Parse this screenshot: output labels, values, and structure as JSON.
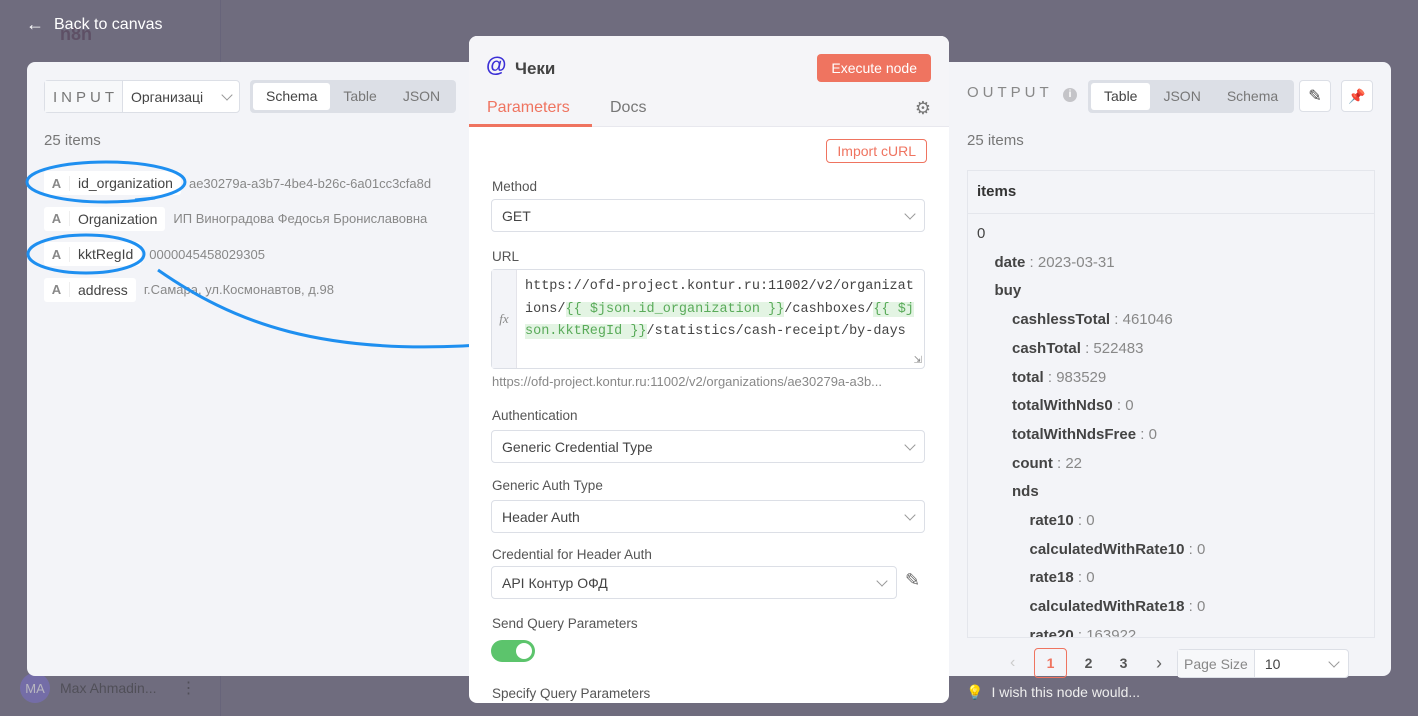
{
  "nav": {
    "back_label": "Back to canvas",
    "logo": "n8n",
    "user_initials": "MA",
    "user_name": "Max Ahmadin..."
  },
  "input": {
    "label": "INPUT",
    "source": "Организаці",
    "views": [
      "Schema",
      "Table",
      "JSON"
    ],
    "active_view": "Schema",
    "count": "25 items",
    "fields": [
      {
        "type": "A",
        "key": "id_organization",
        "value": "ae30279a-a3b7-4be4-b26c-6a01cc3cfa8d"
      },
      {
        "type": "A",
        "key": "Organization",
        "value": "ИП Виноградова Федосья Брониславовна"
      },
      {
        "type": "A",
        "key": "kktRegId",
        "value": "0000045458029305"
      },
      {
        "type": "A",
        "key": "address",
        "value": "г.Самара, ул.Космонавтов, д.98"
      }
    ]
  },
  "node": {
    "title": "Чеки",
    "execute_label": "Execute node",
    "tabs": [
      "Parameters",
      "Docs"
    ],
    "active_tab": "Parameters",
    "import_curl": "Import cURL",
    "method_label": "Method",
    "method": "GET",
    "url_label": "URL",
    "url_parts": [
      "https://ofd-project.kontur.ru:11002/v2/organizations/",
      "{{ $json.id_organization }}",
      "/cashboxes/",
      "{{ $json.kktRegId }}",
      "/statistics/cash-receipt/by-days"
    ],
    "url_preview": "https://ofd-project.kontur.ru:11002/v2/organizations/ae30279a-a3b...",
    "auth_label": "Authentication",
    "auth": "Generic Credential Type",
    "generic_auth_label": "Generic Auth Type",
    "generic_auth": "Header Auth",
    "cred_label": "Credential for Header Auth",
    "cred": "API Контур ОФД",
    "send_query_label": "Send Query Parameters",
    "send_query": true,
    "specify_query_label": "Specify Query Parameters",
    "accent": "#ef7460"
  },
  "output": {
    "label": "OUTPUT",
    "views": [
      "Table",
      "JSON",
      "Schema"
    ],
    "active_view": "Table",
    "count": "25 items",
    "column": "items",
    "rows": [
      {
        "k": "0",
        "v": "",
        "lvl": 0,
        "bold": false
      },
      {
        "k": "date",
        "v": "2023-03-31",
        "lvl": 1
      },
      {
        "k": "buy",
        "v": "",
        "lvl": 1
      },
      {
        "k": "cashlessTotal",
        "v": "461046",
        "lvl": 2
      },
      {
        "k": "cashTotal",
        "v": "522483",
        "lvl": 2
      },
      {
        "k": "total",
        "v": "983529",
        "lvl": 2
      },
      {
        "k": "totalWithNds0",
        "v": "0",
        "lvl": 2
      },
      {
        "k": "totalWithNdsFree",
        "v": "0",
        "lvl": 2
      },
      {
        "k": "count",
        "v": "22",
        "lvl": 2
      },
      {
        "k": "nds",
        "v": "",
        "lvl": 2
      },
      {
        "k": "rate10",
        "v": "0",
        "lvl": 3
      },
      {
        "k": "calculatedWithRate10",
        "v": "0",
        "lvl": 3
      },
      {
        "k": "rate18",
        "v": "0",
        "lvl": 3
      },
      {
        "k": "calculatedWithRate18",
        "v": "0",
        "lvl": 3
      },
      {
        "k": "rate20",
        "v": "163922",
        "lvl": 3
      }
    ],
    "pages": [
      "1",
      "2",
      "3"
    ],
    "current_page": "1",
    "page_size_label": "Page Size",
    "page_size": "10"
  },
  "feedback": "I wish this node would..."
}
